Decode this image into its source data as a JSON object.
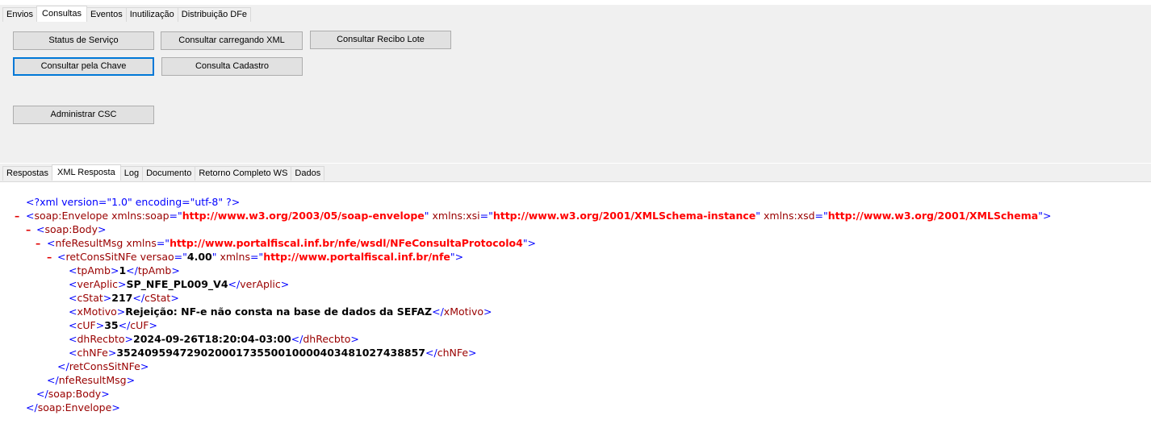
{
  "top_tabs": [
    "Envios",
    "Consultas",
    "Eventos",
    "Inutilização",
    "Distribuição DFe"
  ],
  "active_top_tab": "Consultas",
  "buttons": {
    "status_servico": "Status de Serviço",
    "consultar_xml": "Consultar carregando XML",
    "consultar_recibo": "Consultar Recibo Lote",
    "consultar_chave": "Consultar pela Chave",
    "consulta_cadastro": "Consulta Cadastro",
    "administrar_csc": "Administrar CSC"
  },
  "bottom_tabs": [
    "Respostas",
    "XML Resposta",
    "Log",
    "Documento",
    "Retorno Completo WS",
    "Dados"
  ],
  "active_bottom_tab": "XML Resposta",
  "xml": {
    "decl": "<?xml version=\"1.0\" encoding=\"utf-8\" ?>",
    "envelope_tag": "soap:Envelope",
    "envelope_attrs": [
      {
        "name": "xmlns:soap",
        "value": "http://www.w3.org/2003/05/soap-envelope"
      },
      {
        "name": "xmlns:xsi",
        "value": "http://www.w3.org/2001/XMLSchema-instance"
      },
      {
        "name": "xmlns:xsd",
        "value": "http://www.w3.org/2001/XMLSchema"
      }
    ],
    "body_tag": "soap:Body",
    "result_tag": "nfeResultMsg",
    "result_attr_name": "xmlns",
    "result_attr_value": "http://www.portalfiscal.inf.br/nfe/wsdl/NFeConsultaProtocolo4",
    "ret_tag": "retConsSitNFe",
    "ret_attr1_name": "versao",
    "ret_attr1_value": "4.00",
    "ret_attr2_name": "xmlns",
    "ret_attr2_value": "http://www.portalfiscal.inf.br/nfe",
    "fields": [
      {
        "tag": "tpAmb",
        "value": "1"
      },
      {
        "tag": "verAplic",
        "value": "SP_NFE_PL009_V4"
      },
      {
        "tag": "cStat",
        "value": "217"
      },
      {
        "tag": "xMotivo",
        "value": "Rejeição: NF-e não consta na base de dados da SEFAZ"
      },
      {
        "tag": "cUF",
        "value": "35"
      },
      {
        "tag": "dhRecbto",
        "value": "2024-09-26T18:20:04-03:00"
      },
      {
        "tag": "chNFe",
        "value": "35240959472902000173550010000403481027438857"
      }
    ]
  }
}
